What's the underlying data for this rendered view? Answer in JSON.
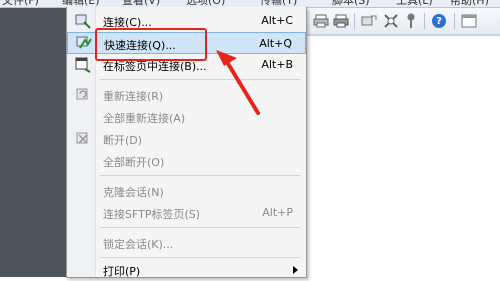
{
  "menubar": {
    "items": [
      "文件(F)",
      "编辑(E)",
      "查看(V)",
      "选项(O)",
      "传输(T)",
      "脚本(S)",
      "工具(L)",
      "帮助(H)"
    ]
  },
  "menu": {
    "items": [
      {
        "label": "连接(C)...",
        "accel": "Alt+C",
        "icon": "connect-icon",
        "enabled": true,
        "highlighted": false
      },
      {
        "label": "快速连接(Q)...",
        "accel": "Alt+Q",
        "icon": "quick-connect-icon",
        "enabled": true,
        "highlighted": true
      },
      {
        "label": "在标签页中连接(B)...",
        "accel": "Alt+B",
        "icon": "connect-in-tab-icon",
        "enabled": true,
        "highlighted": false
      },
      {
        "label": "重新连接(R)",
        "accel": "",
        "icon": "reconnect-icon",
        "enabled": false,
        "highlighted": false
      },
      {
        "label": "全部重新连接(A)",
        "accel": "",
        "icon": "",
        "enabled": false,
        "highlighted": false
      },
      {
        "label": "断开(D)",
        "accel": "",
        "icon": "disconnect-icon",
        "enabled": false,
        "highlighted": false
      },
      {
        "label": "全部断开(O)",
        "accel": "",
        "icon": "",
        "enabled": false,
        "highlighted": false
      },
      {
        "label": "克隆会话(N)",
        "accel": "",
        "icon": "",
        "enabled": false,
        "highlighted": false
      },
      {
        "label": "连接SFTP标签页(S)",
        "accel": "Alt+P",
        "icon": "",
        "enabled": false,
        "highlighted": false
      },
      {
        "label": "锁定会话(K)...",
        "accel": "",
        "icon": "",
        "enabled": false,
        "highlighted": false
      },
      {
        "label": "打印(P)",
        "accel": "",
        "icon": "",
        "enabled": true,
        "highlighted": false
      }
    ]
  },
  "colors": {
    "highlight": "#cfe4f7",
    "annotation": "#e8241a"
  }
}
